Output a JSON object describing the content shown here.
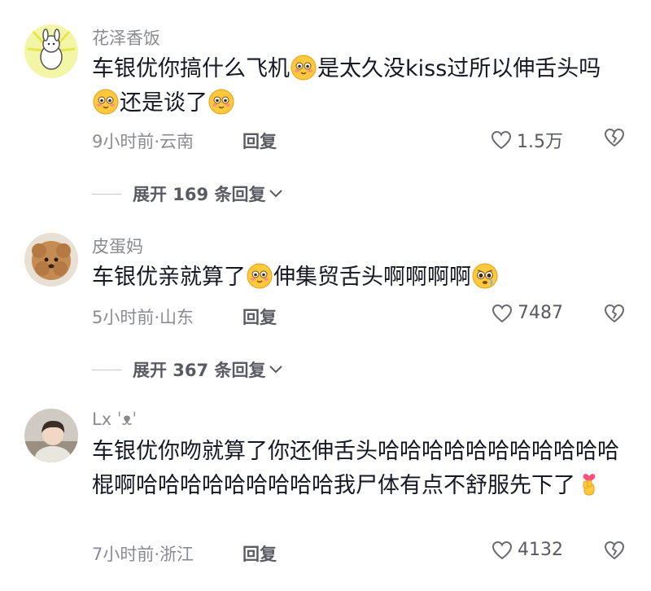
{
  "comments": [
    {
      "username": "花泽香饭",
      "content_parts": [
        "车银优你搞什么飞机",
        "是太久没kiss过所以伸舌头吗",
        "还是谈了"
      ],
      "time_location": "9小时前·云南",
      "reply_label": "回复",
      "likes": "1.5万",
      "expand_label": "展开 169 条回复"
    },
    {
      "username": "皮蛋妈",
      "content_parts": [
        "车银优亲就算了",
        "伸集贸舌头啊啊啊啊"
      ],
      "time_location": "5小时前·山东",
      "reply_label": "回复",
      "likes": "7487",
      "expand_label": "展开 367 条回复"
    },
    {
      "username": "Lx ˈᴥˈ",
      "content": "车银优你吻就算了你还伸舌头哈哈哈哈哈哈哈哈哈哈哈棍啊哈哈哈哈哈哈哈哈哈我尸体有点不舒服先下了",
      "time_location": "7小时前·浙江",
      "reply_label": "回复",
      "likes": "4132"
    }
  ],
  "icons": {
    "like": "heart-outline-icon",
    "dislike": "broken-heart-icon",
    "expand": "chevron-down-icon",
    "emoji_smile": "shy-smile-emoji",
    "emoji_plead": "pleading-face-emoji",
    "emoji_heart_hand": "finger-heart-emoji"
  },
  "colors": {
    "text": "#161823",
    "muted": "#8a8b91",
    "secondary": "#5a5b62",
    "emoji_yellow": "#ffc83d"
  }
}
